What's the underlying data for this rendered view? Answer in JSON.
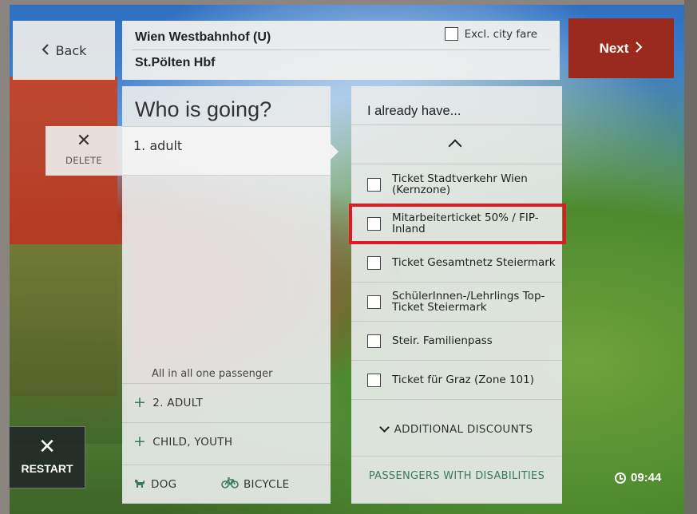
{
  "nav": {
    "back_label": "Back",
    "next_label": "Next"
  },
  "route": {
    "from": "Wien Westbahnhof (U)",
    "to": "St.Pölten Hbf",
    "excl_city_fare_label": "Excl. city fare",
    "excl_city_fare_checked": false
  },
  "passengers": {
    "title": "Who is going?",
    "list": [
      {
        "label": "1.  adult"
      }
    ],
    "delete_label": "DELETE",
    "summary": "All in all one passenger",
    "add_adult_label": "2. ADULT",
    "add_child_label": "CHILD, YOUTH",
    "dog_label": "DOG",
    "bicycle_label": "BICYCLE"
  },
  "discounts": {
    "title": "I already have...",
    "items": [
      {
        "label": "Ticket Stadtverkehr Wien (Kernzone)",
        "checked": false
      },
      {
        "label": "Mitarbeiterticket 50% / FIP-Inland",
        "checked": false,
        "highlighted": true
      },
      {
        "label": "Ticket Gesamtnetz Steiermark",
        "checked": false
      },
      {
        "label": "SchülerInnen-/Lehrlings Top-Ticket Steiermark",
        "checked": false
      },
      {
        "label": "Steir. Familienpass",
        "checked": false
      },
      {
        "label": "Ticket für Graz (Zone 101)",
        "checked": false
      }
    ],
    "additional_label": "ADDITIONAL DISCOUNTS",
    "disabilities_label": "PASSENGERS WITH DISABILITIES"
  },
  "footer": {
    "restart_label": "RESTART",
    "time": "09:44"
  },
  "colors": {
    "next_bg": "#9b2a1e",
    "highlight": "#e01a22",
    "green_text": "#3a7a5a"
  }
}
